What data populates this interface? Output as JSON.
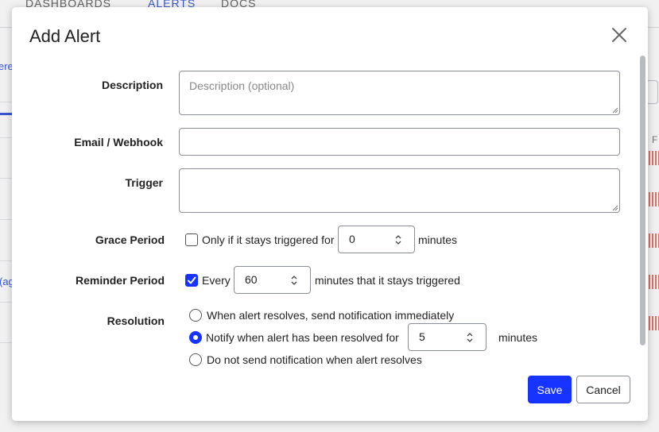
{
  "background": {
    "nav": {
      "dashboards": "DASHBOARDS",
      "alerts": "ALERTS",
      "docs": "DOCS"
    },
    "left_fragments": [
      "ere",
      "(ag"
    ],
    "right_fragment": "F",
    "colors": {
      "accent": "#3b5bdb",
      "bars": "#e8756b"
    }
  },
  "modal": {
    "title": "Add Alert",
    "close_icon": "close-icon",
    "fields": {
      "description": {
        "label": "Description",
        "placeholder": "Description (optional)",
        "value": ""
      },
      "email": {
        "label": "Email / Webhook",
        "value": ""
      },
      "trigger": {
        "label": "Trigger",
        "value": ""
      },
      "grace_period": {
        "label": "Grace Period",
        "checked": false,
        "prefix": "Only if it stays triggered for",
        "value": "0",
        "suffix": "minutes"
      },
      "reminder_period": {
        "label": "Reminder Period",
        "checked": true,
        "prefix": "Every",
        "value": "60",
        "suffix": "minutes that it stays triggered"
      },
      "resolution": {
        "label": "Resolution",
        "options": [
          {
            "label": "When alert resolves, send notification immediately",
            "selected": false
          },
          {
            "label": "Notify when alert has been resolved for",
            "selected": true,
            "value": "5",
            "suffix": "minutes"
          },
          {
            "label": "Do not send notification when alert resolves",
            "selected": false
          }
        ]
      }
    },
    "buttons": {
      "save": "Save",
      "cancel": "Cancel"
    },
    "colors": {
      "primary": "#1733ff",
      "border": "#8a8f96"
    }
  }
}
